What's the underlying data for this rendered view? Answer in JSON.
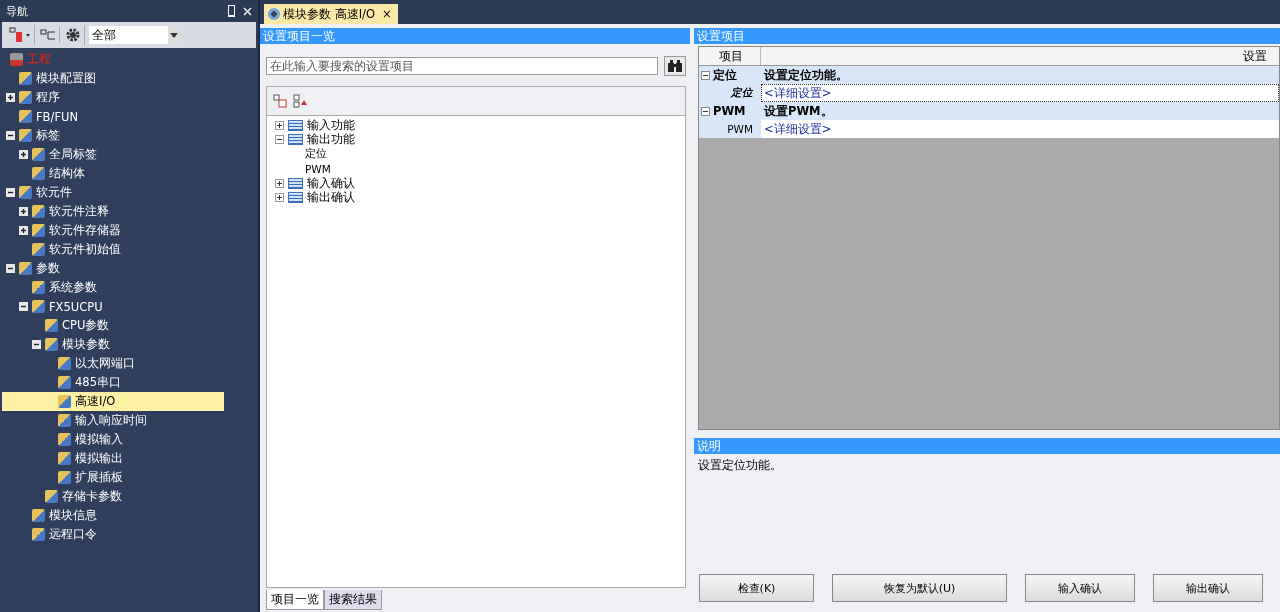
{
  "nav": {
    "title": "导航",
    "filter": "全部",
    "project": "工程",
    "items": [
      {
        "label": "模块配置图"
      },
      {
        "label": "程序",
        "expanded": false
      },
      {
        "label": "FB/FUN"
      },
      {
        "label": "标签",
        "expanded": true,
        "children": [
          {
            "label": "全局标签",
            "expanded": false
          },
          {
            "label": "结构体"
          }
        ]
      },
      {
        "label": "软元件",
        "expanded": true,
        "children": [
          {
            "label": "软元件注释",
            "expanded": false
          },
          {
            "label": "软元件存储器",
            "expanded": false
          },
          {
            "label": "软元件初始值"
          }
        ]
      },
      {
        "label": "参数",
        "expanded": true,
        "children": [
          {
            "label": "系统参数"
          },
          {
            "label": "FX5UCPU",
            "expanded": true,
            "children": [
              {
                "label": "CPU参数"
              },
              {
                "label": "模块参数",
                "expanded": true,
                "children": [
                  {
                    "label": "以太网端口",
                    "selected": false
                  },
                  {
                    "label": "485串口",
                    "selected": false
                  },
                  {
                    "label": "高速I/O",
                    "selected": true
                  },
                  {
                    "label": "输入响应时间",
                    "selected": false
                  },
                  {
                    "label": "模拟输入",
                    "selected": false
                  },
                  {
                    "label": "模拟输出",
                    "selected": false
                  },
                  {
                    "label": "扩展插板",
                    "selected": false
                  }
                ]
              },
              {
                "label": "存储卡参数"
              }
            ]
          },
          {
            "label": "模块信息"
          },
          {
            "label": "远程口令"
          }
        ]
      }
    ]
  },
  "tab": {
    "label": "模块参数 高速I/O",
    "close": "×"
  },
  "list_pane": {
    "title": "设置项目一览",
    "search": {
      "placeholder": "在此输入要搜索的设置项目"
    },
    "tree": [
      {
        "label": "输入功能",
        "expanded": false
      },
      {
        "label": "输出功能",
        "expanded": true,
        "children": [
          {
            "label": "定位"
          },
          {
            "label": "PWM"
          }
        ]
      },
      {
        "label": "输入确认",
        "expanded": false
      },
      {
        "label": "输出确认",
        "expanded": false
      }
    ],
    "tabs": [
      {
        "label": "项目一览",
        "selected": true
      },
      {
        "label": "搜索结果",
        "selected": false
      }
    ]
  },
  "settings_pane": {
    "title": "设置项目",
    "columns": [
      "项目",
      "设置"
    ],
    "groups": [
      {
        "label": "定位",
        "expanded": true,
        "description": "设置定位功能。",
        "rows": [
          {
            "label": "定位",
            "value": "<详细设置>",
            "selected": true
          }
        ]
      },
      {
        "label": "PWM",
        "expanded": true,
        "description": "设置PWM。",
        "rows": [
          {
            "label": "PWM",
            "value": "<详细设置>",
            "selected": false
          }
        ]
      }
    ]
  },
  "help": {
    "title": "说明",
    "text": "设置定位功能。"
  },
  "buttons": [
    "检查(K)",
    "恢复为默认(U)",
    "输入确认",
    "输出确认"
  ]
}
